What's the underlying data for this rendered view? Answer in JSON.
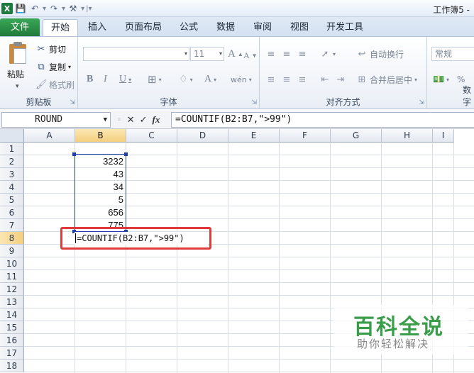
{
  "titlebar": {
    "doc_title": "工作簿5 -"
  },
  "tabs": [
    {
      "label": "文件"
    },
    {
      "label": "开始"
    },
    {
      "label": "插入"
    },
    {
      "label": "页面布局"
    },
    {
      "label": "公式"
    },
    {
      "label": "数据"
    },
    {
      "label": "审阅"
    },
    {
      "label": "视图"
    },
    {
      "label": "开发工具"
    }
  ],
  "ribbon": {
    "clipboard": {
      "paste": "粘贴",
      "cut": "剪切",
      "copy": "复制",
      "format_painter": "格式刷",
      "group_label": "剪贴板"
    },
    "font": {
      "font_size": "11",
      "group_label": "字体",
      "bold": "B",
      "italic": "I",
      "underline": "U",
      "grow": "A",
      "shrink": "A"
    },
    "alignment": {
      "wrap": "自动换行",
      "merge": "合并后居中",
      "group_label": "对齐方式"
    },
    "number": {
      "format": "常规",
      "percent": "%",
      "group_label": "数字"
    }
  },
  "formula_bar": {
    "name_box": "ROUND",
    "fx": "fx",
    "formula": "=COUNTIF(B2:B7,\">99\")"
  },
  "sheet": {
    "columns": [
      "A",
      "B",
      "C",
      "D",
      "E",
      "F",
      "G",
      "H",
      "I"
    ],
    "rows": [
      "1",
      "2",
      "3",
      "4",
      "5",
      "6",
      "7",
      "8",
      "9",
      "10",
      "11",
      "12",
      "13",
      "14",
      "15",
      "16",
      "17",
      "18"
    ],
    "b_values": [
      "3232",
      "43",
      "34",
      "5",
      "656",
      "775"
    ],
    "edit_text": "=COUNTIF(B2:B7,\">99\")"
  },
  "watermark": {
    "title": "百科全说",
    "subtitle": "助你轻松解决"
  }
}
